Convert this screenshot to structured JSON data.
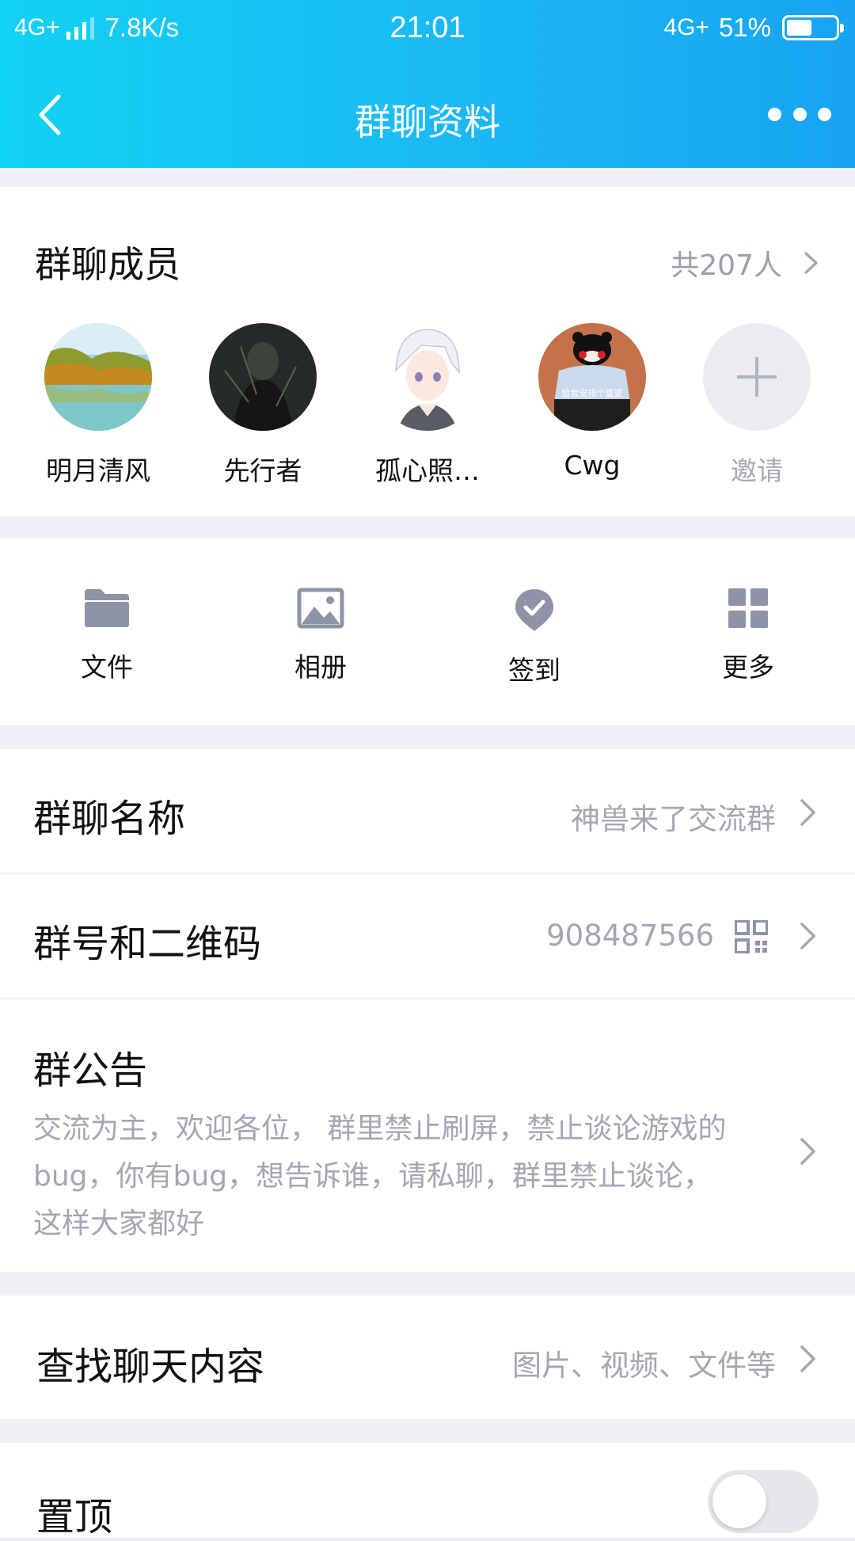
{
  "status_bar": {
    "network_left": "4G+",
    "speed": "7.8K/s",
    "time": "21:01",
    "network_right": "4G+",
    "battery_percent": "51%",
    "battery_level": 0.51
  },
  "nav": {
    "title": "群聊资料",
    "back_icon": "chevron-left-icon",
    "more_icon": "more-dots-icon"
  },
  "members": {
    "title": "群聊成员",
    "count": "共207人",
    "list": [
      {
        "name": "明月清风",
        "avatar": "landscape-lake"
      },
      {
        "name": "先行者",
        "avatar": "dark-portrait"
      },
      {
        "name": "孤心照…",
        "avatar": "anime-boy-white-hair"
      },
      {
        "name": "Cwg",
        "avatar": "kumamon-meme"
      }
    ],
    "avatar_caption": "给我安排个富婆",
    "invite_label": "邀请"
  },
  "tools": [
    {
      "label": "文件",
      "icon": "folder-icon"
    },
    {
      "label": "相册",
      "icon": "image-icon"
    },
    {
      "label": "签到",
      "icon": "checkin-pin-icon"
    },
    {
      "label": "更多",
      "icon": "grid-icon"
    }
  ],
  "group_name": {
    "label": "群聊名称",
    "value": "神兽来了交流群"
  },
  "group_id": {
    "label": "群号和二维码",
    "value": "908487566",
    "icon": "qr-code-icon"
  },
  "notice": {
    "label": "群公告",
    "line1": "交流为主，欢迎各位， 群里禁止刷屏，禁止谈论游戏的",
    "line2": "bug，你有bug，想告诉谁，请私聊，群里禁止谈论，",
    "line3": "这样大家都好"
  },
  "search": {
    "label": "查找聊天内容",
    "value": "图片、视频、文件等"
  },
  "pin": {
    "label": "置顶",
    "enabled": false
  },
  "colors": {
    "accent": "#12b4f4",
    "secondary_text": "#a4a7b1",
    "icon_gray": "#8e93a6"
  }
}
